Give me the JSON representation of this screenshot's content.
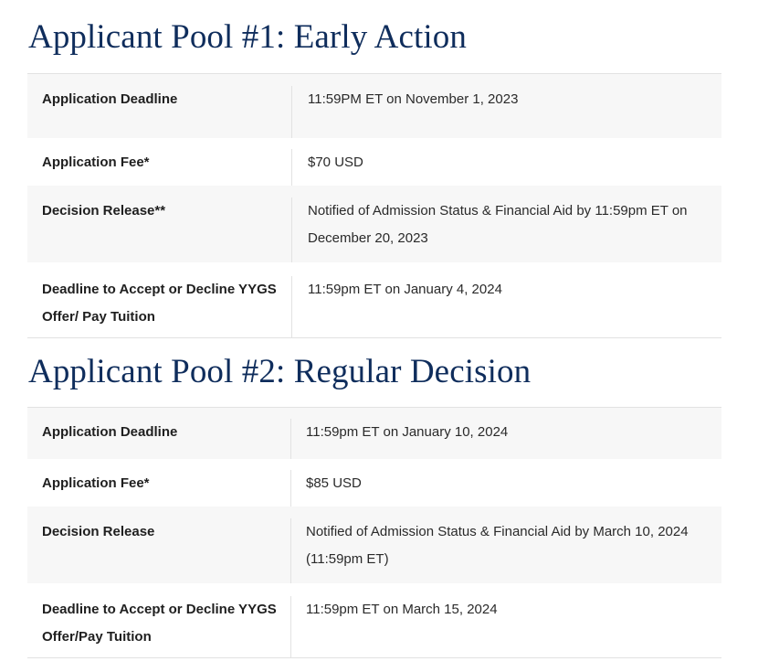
{
  "sections": [
    {
      "title": "Applicant Pool #1: Early Action",
      "rows": [
        {
          "label": "Application Deadline",
          "value": "11:59PM ET on November 1, 2023"
        },
        {
          "label": "Application Fee*",
          "value": "$70 USD"
        },
        {
          "label": "Decision Release**",
          "value": "Notified of Admission Status & Financial Aid by 11:59pm ET on December 20, 2023"
        },
        {
          "label": "Deadline to Accept or Decline YYGS Offer/ Pay Tuition",
          "value": "11:59pm ET on January 4, 2024"
        }
      ]
    },
    {
      "title": "Applicant Pool #2: Regular Decision",
      "rows": [
        {
          "label": "Application Deadline",
          "value": "11:59pm ET on January 10, 2024"
        },
        {
          "label": "Application Fee*",
          "value": "$85 USD"
        },
        {
          "label": "Decision Release",
          "value": "Notified of Admission Status & Financial Aid by March 10, 2024 (11:59pm ET)"
        },
        {
          "label": "Deadline to Accept or Decline YYGS Offer/Pay Tuition",
          "value": "11:59pm ET on March 15, 2024"
        }
      ]
    }
  ],
  "colors": {
    "title": "#0f2d5c",
    "row_shade": "#f7f7f7",
    "border": "#e2e2e2"
  }
}
